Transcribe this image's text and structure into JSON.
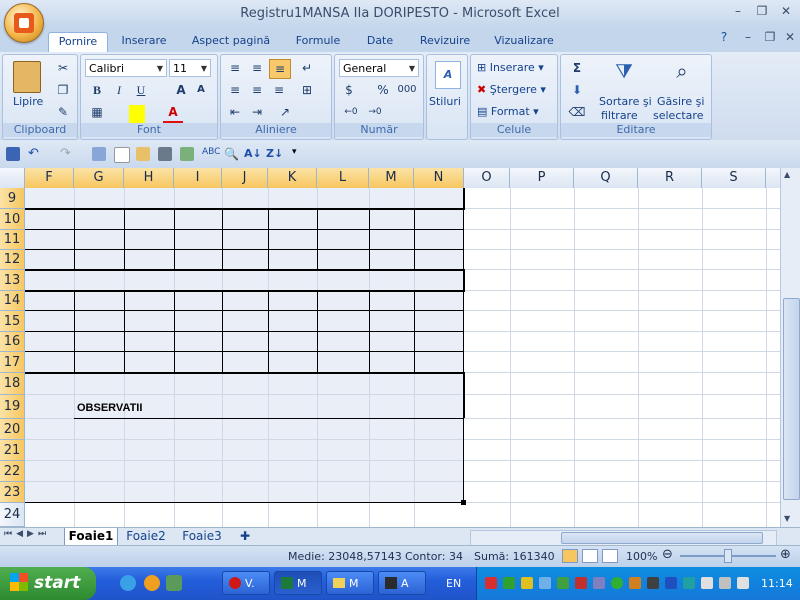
{
  "window": {
    "title": "Registru1MANSA IIa DORIPESTO - Microsoft Excel",
    "minimize": "–",
    "restore": "❐",
    "close": "✕"
  },
  "ribbon_tabs": [
    "Pornire",
    "Inserare",
    "Aspect pagină",
    "Formule",
    "Date",
    "Revizuire",
    "Vizualizare"
  ],
  "ribbon": {
    "clipboard": {
      "label": "Clipboard",
      "paste": "Lipire"
    },
    "font": {
      "label": "Font",
      "name": "Calibri",
      "size": "11",
      "bold": "B",
      "italic": "I",
      "underline": "U"
    },
    "alignment": {
      "label": "Aliniere"
    },
    "number": {
      "label": "Număr",
      "format": "General",
      "percent": "%",
      "thousands": "000"
    },
    "styles": {
      "label": "Stiluri"
    },
    "cells": {
      "label": "Celule",
      "insert": "Inserare",
      "delete": "Ştergere",
      "format": "Format"
    },
    "editing": {
      "label": "Editare",
      "sum": "Σ",
      "sort_line1": "Sortare şi",
      "sort_line2": "filtrare",
      "find_line1": "Găsire şi",
      "find_line2": "selectare"
    }
  },
  "grid": {
    "columns": [
      "F",
      "G",
      "H",
      "I",
      "J",
      "K",
      "L",
      "M",
      "N",
      "O",
      "P",
      "Q",
      "R",
      "S"
    ],
    "rows": [
      "9",
      "10",
      "11",
      "12",
      "13",
      "14",
      "15",
      "16",
      "17",
      "18",
      "19",
      "20",
      "21",
      "22",
      "23",
      "24"
    ],
    "cell_text": "OBSERVATII"
  },
  "sheet_tabs": [
    "Foaie1",
    "Foaie2",
    "Foaie3"
  ],
  "status": {
    "average": "Medie: 23048,57143",
    "count": "Contor: 34",
    "sum": "Sumă: 161340",
    "zoom": "100%"
  },
  "taskbar": {
    "start": "start",
    "buttons": [
      "V.",
      "M",
      "M",
      "A"
    ],
    "lang": "EN",
    "clock": "11:14"
  },
  "colors": {
    "ribbon_text": "#15428b",
    "selection_header": "#f7c65f",
    "taskbar": "#245edb"
  }
}
